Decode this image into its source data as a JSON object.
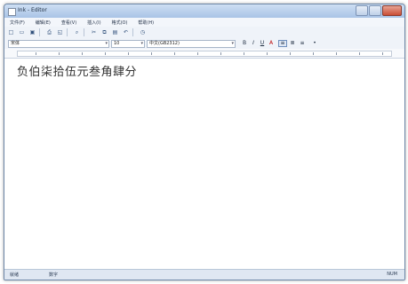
{
  "window": {
    "title": "Ink - Editor"
  },
  "menubar": {
    "items": [
      "文件(F)",
      "编辑(E)",
      "查看(V)",
      "插入(I)",
      "格式(O)",
      "帮助(H)"
    ]
  },
  "toolbar": {
    "buttons": [
      {
        "name": "new-icon",
        "glyph": "□"
      },
      {
        "name": "open-icon",
        "glyph": "▭"
      },
      {
        "name": "save-icon",
        "glyph": "▣"
      },
      {
        "name": "print-icon",
        "glyph": "⎙"
      },
      {
        "name": "preview-icon",
        "glyph": "◱"
      },
      {
        "name": "find-icon",
        "glyph": "⌕"
      },
      {
        "name": "cut-icon",
        "glyph": "✂"
      },
      {
        "name": "copy-icon",
        "glyph": "⧉"
      },
      {
        "name": "paste-icon",
        "glyph": "▤"
      },
      {
        "name": "undo-icon",
        "glyph": "↶"
      },
      {
        "name": "insert-date-icon",
        "glyph": "◷"
      }
    ]
  },
  "format_bar": {
    "font": "宋体",
    "size": "10",
    "script": "中文(GB2312)",
    "buttons": [
      {
        "name": "bold-icon",
        "glyph": "B",
        "active": false
      },
      {
        "name": "italic-icon",
        "glyph": "I",
        "active": false
      },
      {
        "name": "underline-icon",
        "glyph": "U",
        "active": false
      },
      {
        "name": "color-icon",
        "glyph": "A",
        "active": false
      },
      {
        "name": "align-left-icon",
        "glyph": "≡",
        "active": true
      },
      {
        "name": "align-center-icon",
        "glyph": "≣",
        "active": false
      },
      {
        "name": "align-right-icon",
        "glyph": "≡",
        "active": false
      },
      {
        "name": "bullets-icon",
        "glyph": "•",
        "active": false
      }
    ]
  },
  "document": {
    "text": "负伯柒拾伍元叁角肆分"
  },
  "status": {
    "left": "就绪",
    "middle": "数字",
    "right": "NUM"
  },
  "colors": {
    "accent": "#6d87a8",
    "background": "#eaf1fa"
  }
}
